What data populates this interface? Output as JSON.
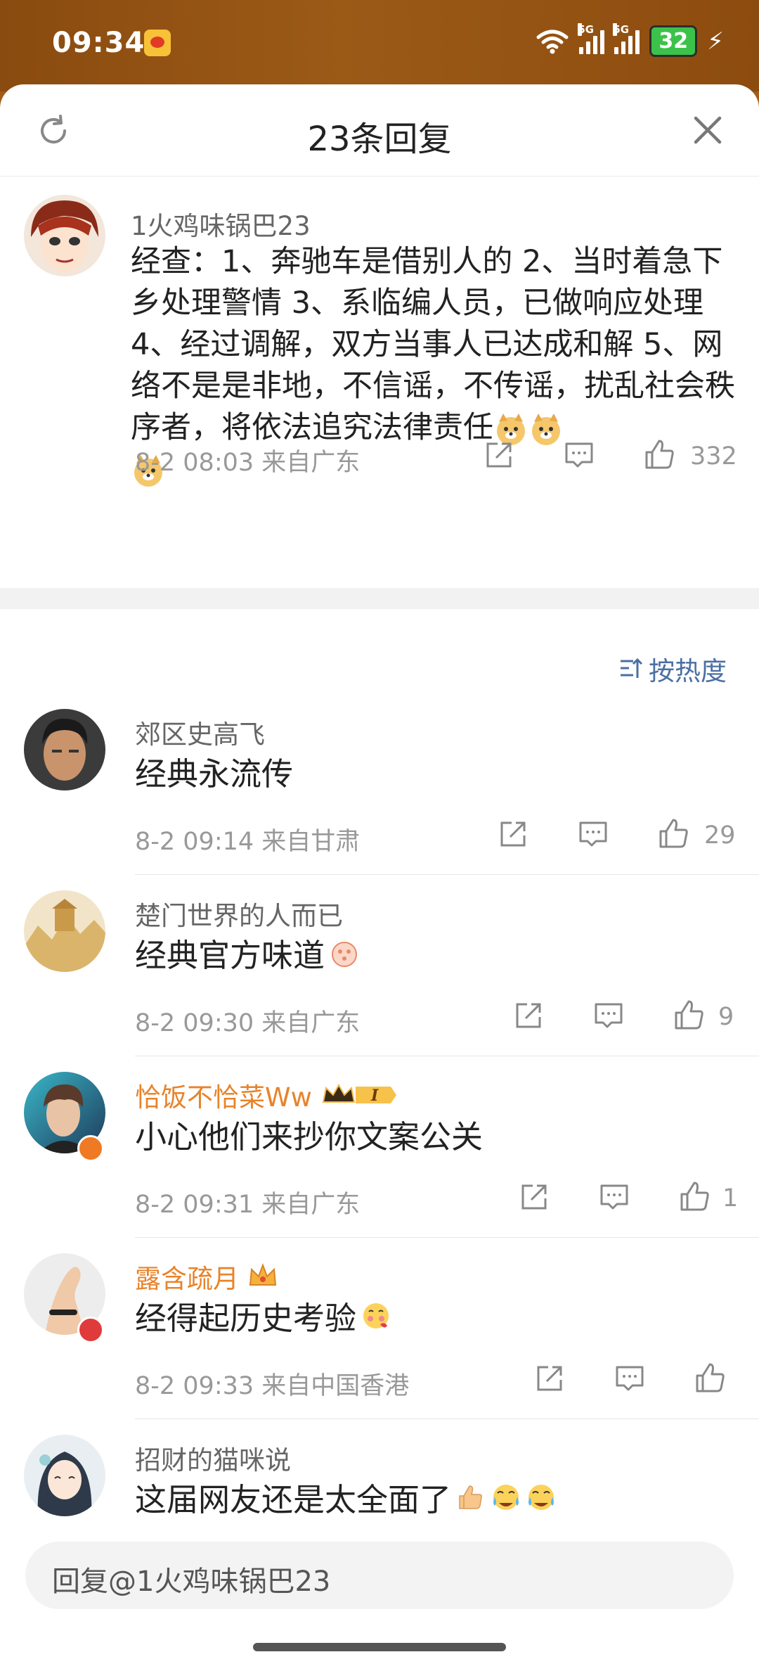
{
  "status_bar": {
    "time": "09:34",
    "battery": "32"
  },
  "header": {
    "title": "23条回复"
  },
  "main_comment": {
    "author": "1火鸡味锅巴23",
    "text": "经查：1、奔驰车是借别人的 2、当时着急下乡处理警情 3、系临编人员，已做响应处理  4、经过调解，双方当事人已达成和解 5、网络不是是非地，不信谣，不传谣，扰乱社会秩序者，将依法追究法律责任",
    "date": "8-2 08:03",
    "location": "来自广东",
    "likes": "332"
  },
  "sort": {
    "label": "按热度"
  },
  "replies": [
    {
      "author": "郊区史高飞",
      "text": "经典永流传",
      "date": "8-2 09:14",
      "location": "来自甘肃",
      "likes": "29"
    },
    {
      "author": "楚门世界的人而已",
      "text": "经典官方味道",
      "date": "8-2 09:30",
      "location": "来自广东",
      "likes": "9"
    },
    {
      "author": "恰饭不恰菜Ww",
      "text": "小心他们来抄你文案公关",
      "date": "8-2 09:31",
      "location": "来自广东",
      "likes": "1",
      "level_badge": "I"
    },
    {
      "author": "露含疏月",
      "text": "经得起历史考验",
      "date": "8-2 09:33",
      "location": "来自中国香港",
      "likes": ""
    },
    {
      "author": "招财的猫咪说",
      "text": "这届网友还是太全面了"
    }
  ],
  "reply_box": {
    "placeholder": "回复@1火鸡味锅巴23"
  },
  "colors": {
    "vip_name": "#e8832a",
    "sort_link": "#4a6fa3",
    "meta": "#999999"
  }
}
